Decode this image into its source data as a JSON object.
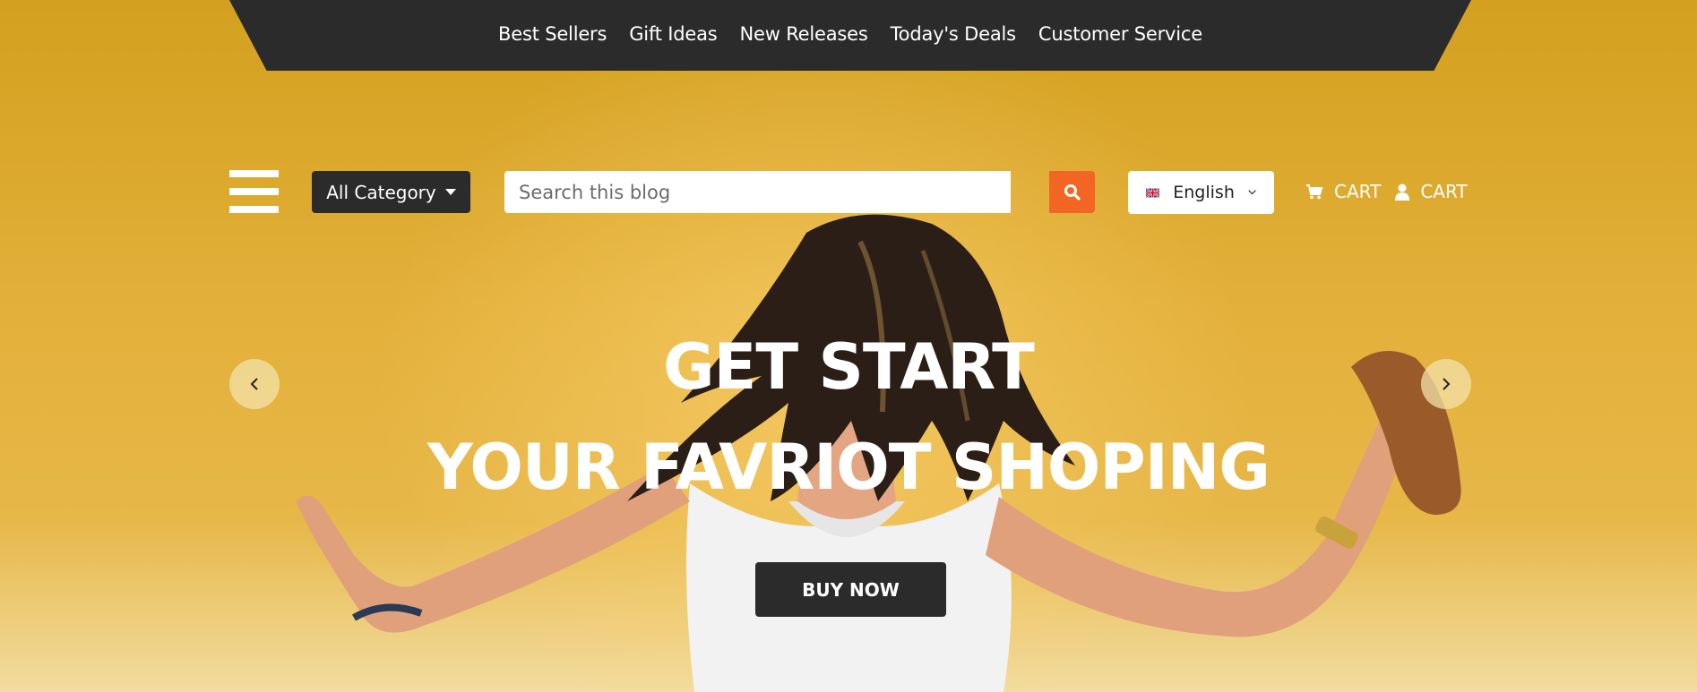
{
  "top_nav": {
    "items": [
      {
        "label": "Best Sellers"
      },
      {
        "label": "Gift Ideas"
      },
      {
        "label": "New Releases"
      },
      {
        "label": "Today's Deals"
      },
      {
        "label": "Customer Service"
      }
    ]
  },
  "header": {
    "menu_icon": "hamburger-icon",
    "category_label": "All Category",
    "search": {
      "placeholder": "Search this blog",
      "value": "",
      "icon": "search-icon"
    },
    "language": {
      "selected": "English",
      "flag_icon": "uk-flag-icon",
      "chevron_icon": "chevron-down-icon"
    },
    "cart": {
      "label": "CART",
      "icon": "cart-icon"
    },
    "account": {
      "label": "CART",
      "icon": "user-icon"
    }
  },
  "hero": {
    "line1": "GET START",
    "line2": "YOUR FAVRIOT SHOPING",
    "cta": "BUY NOW",
    "prev_icon": "chevron-left-icon",
    "next_icon": "chevron-right-icon"
  },
  "colors": {
    "background": "#d9a526",
    "dark": "#2b2b2b",
    "accent": "#f26522",
    "text_light": "#ffffff"
  }
}
